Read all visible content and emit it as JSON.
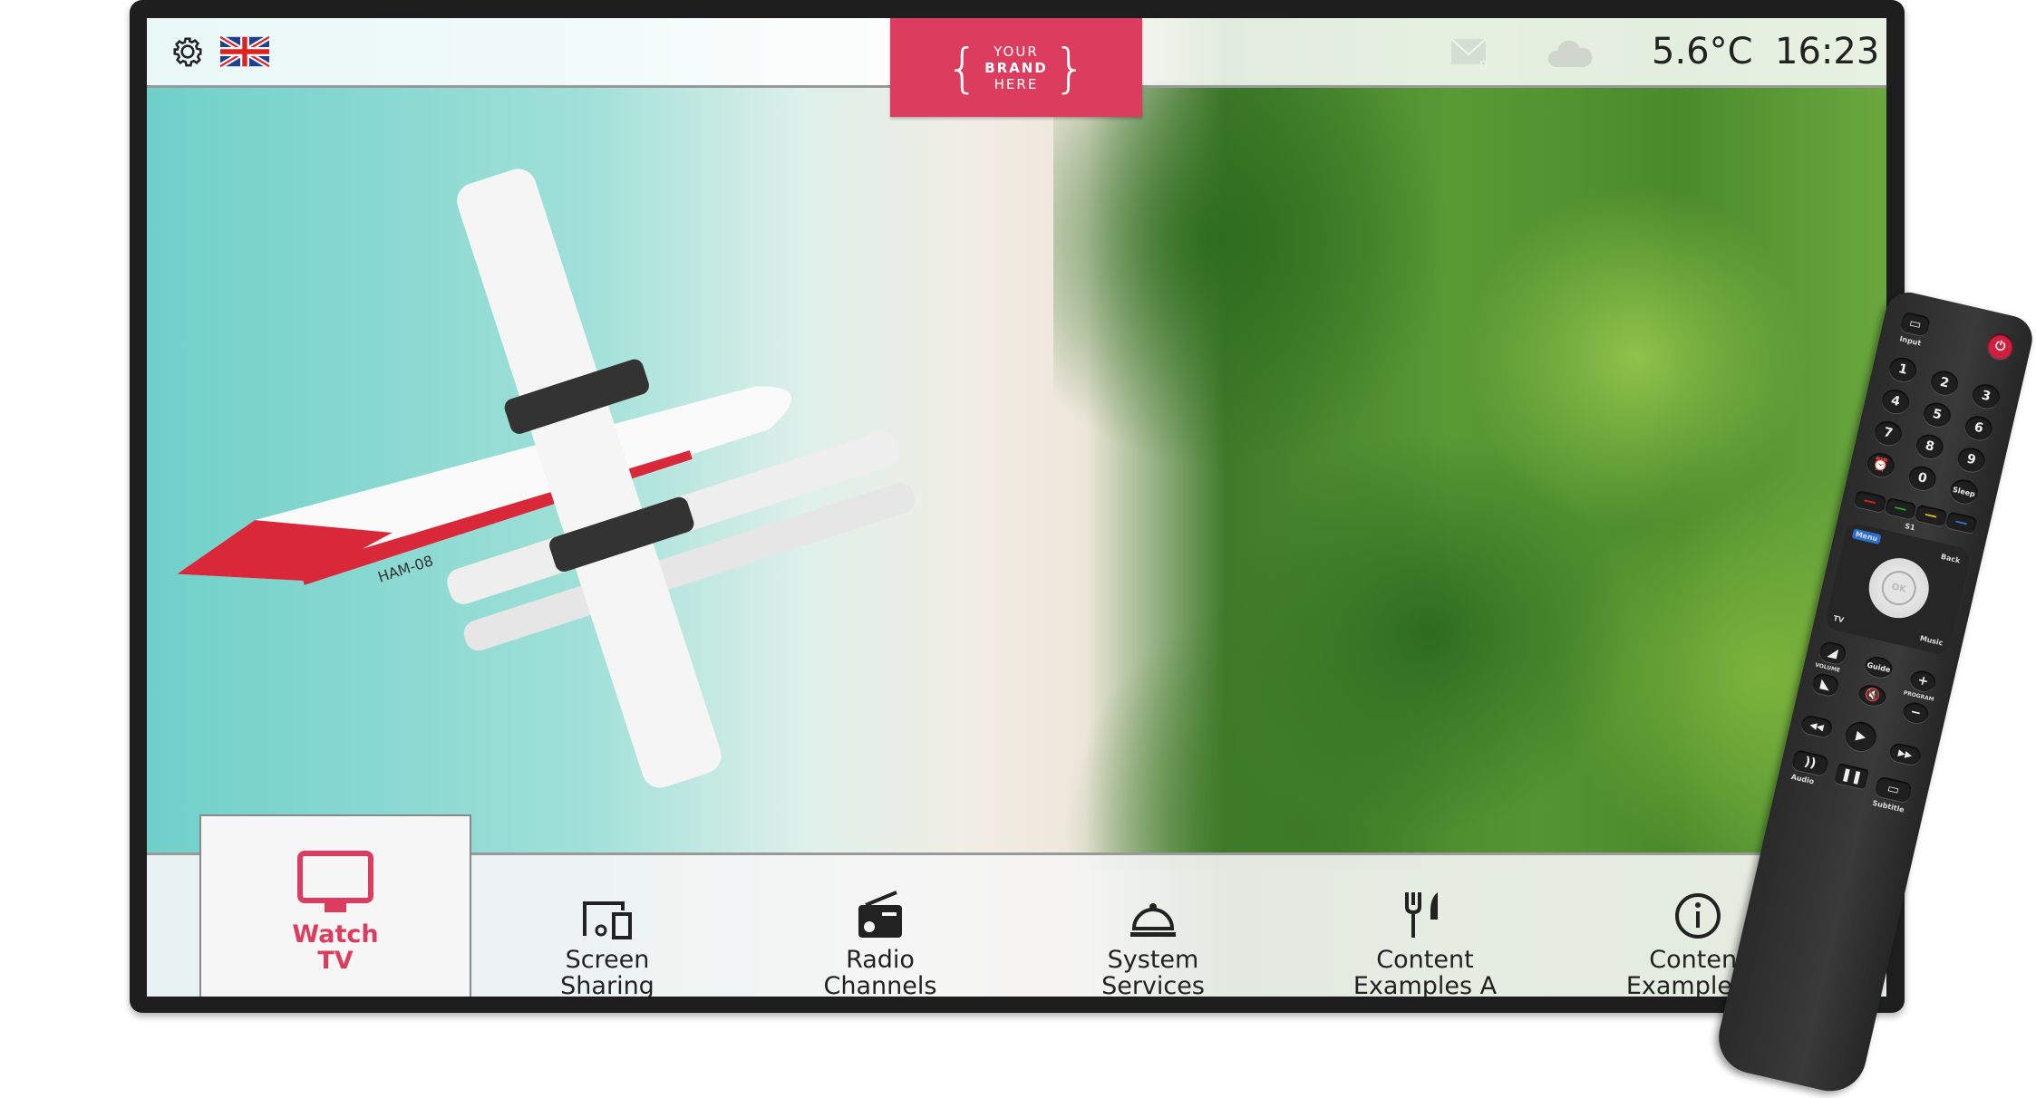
{
  "topbar": {
    "settings_icon": "gear-icon",
    "language_icon": "uk-flag-icon",
    "brand": {
      "line1": "YOUR",
      "line2": "BRAND",
      "line3": "HERE"
    },
    "mail_icon": "envelope-icon",
    "mail_count": "0",
    "weather_icon": "cloud-icon",
    "temperature": "5.6°C",
    "time": "16:23"
  },
  "colors": {
    "accent": "#dc3d5e",
    "text": "#222222"
  },
  "menu": {
    "items": [
      {
        "label1": "Watch",
        "label2": "TV",
        "icon": "tv-icon",
        "active": true
      },
      {
        "label1": "Screen",
        "label2": "Sharing",
        "icon": "screen-sharing-icon"
      },
      {
        "label1": "Radio",
        "label2": "Channels",
        "icon": "radio-icon"
      },
      {
        "label1": "System",
        "label2": "Services",
        "icon": "service-bell-icon"
      },
      {
        "label1": "Content",
        "label2": "Examples A",
        "icon": "fork-knife-icon"
      },
      {
        "label1": "Content",
        "label2": "Examples B",
        "icon": "info-icon"
      }
    ]
  },
  "remote": {
    "input": "Input",
    "digits": [
      "1",
      "2",
      "3",
      "4",
      "5",
      "6",
      "7",
      "8",
      "9",
      "0"
    ],
    "sleep": "Sleep",
    "s1": "S1",
    "menu": "Menu",
    "back": "Back",
    "ok": "OK",
    "tv": "TV",
    "music": "Music",
    "volume": "VOLUME",
    "guide": "Guide",
    "program": "PROGRAM",
    "plus": "+",
    "minus": "−",
    "audio": "Audio",
    "subtitle": "Subtitle"
  },
  "plane_reg": "HAM-08"
}
